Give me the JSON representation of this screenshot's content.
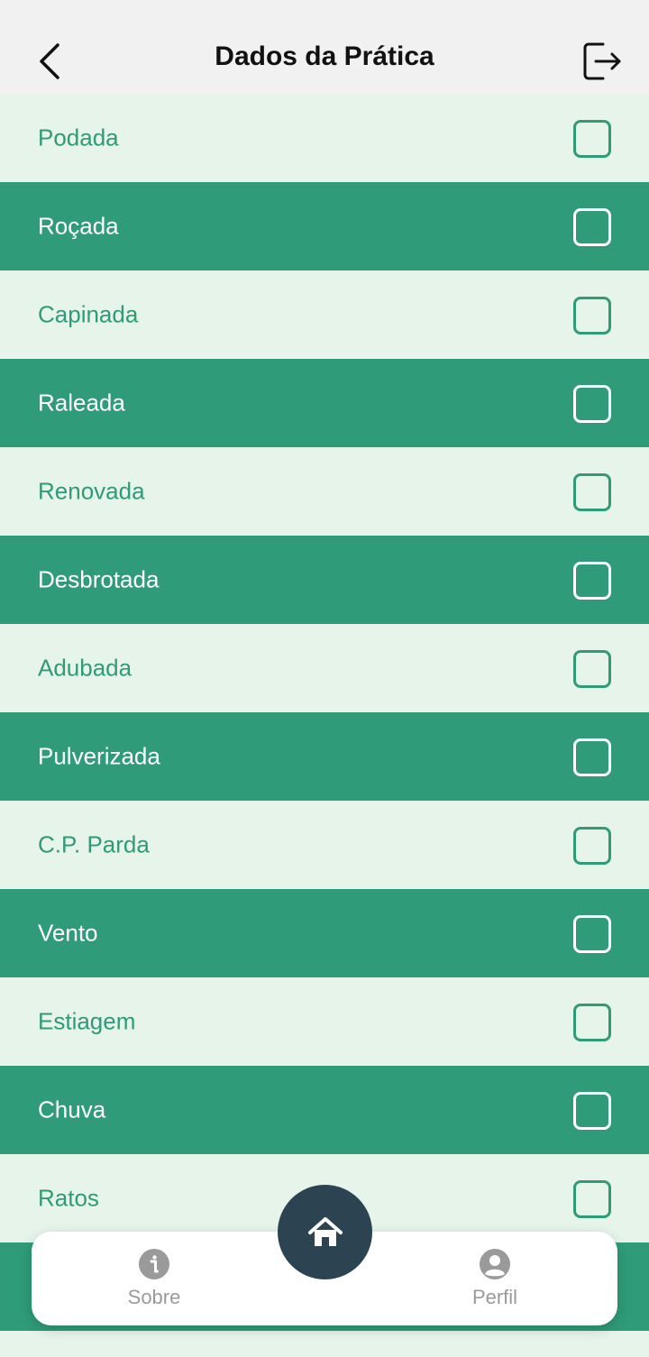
{
  "header": {
    "title": "Dados da Prática",
    "back_icon": "chevron-left-icon",
    "logout_icon": "logout-icon"
  },
  "items": [
    {
      "label": "Podada",
      "checked": false
    },
    {
      "label": "Roçada",
      "checked": false
    },
    {
      "label": "Capinada",
      "checked": false
    },
    {
      "label": "Raleada",
      "checked": false
    },
    {
      "label": "Renovada",
      "checked": false
    },
    {
      "label": "Desbrotada",
      "checked": false
    },
    {
      "label": "Adubada",
      "checked": false
    },
    {
      "label": "Pulverizada",
      "checked": false
    },
    {
      "label": "C.P. Parda",
      "checked": false
    },
    {
      "label": "Vento",
      "checked": false
    },
    {
      "label": "Estiagem",
      "checked": false
    },
    {
      "label": "Chuva",
      "checked": false
    },
    {
      "label": "Ratos",
      "checked": false
    },
    {
      "label": "",
      "checked": false
    }
  ],
  "bottom_nav": {
    "sobre_label": "Sobre",
    "perfil_label": "Perfil",
    "home_icon": "home-icon",
    "sobre_icon": "info-icon",
    "perfil_icon": "user-icon"
  },
  "colors": {
    "primary_green": "#2f9b78",
    "light_green_bg": "#e6f4ea",
    "header_bg": "#f1f1f1",
    "home_button": "#2c4451",
    "nav_gray": "#9a9a9a"
  }
}
